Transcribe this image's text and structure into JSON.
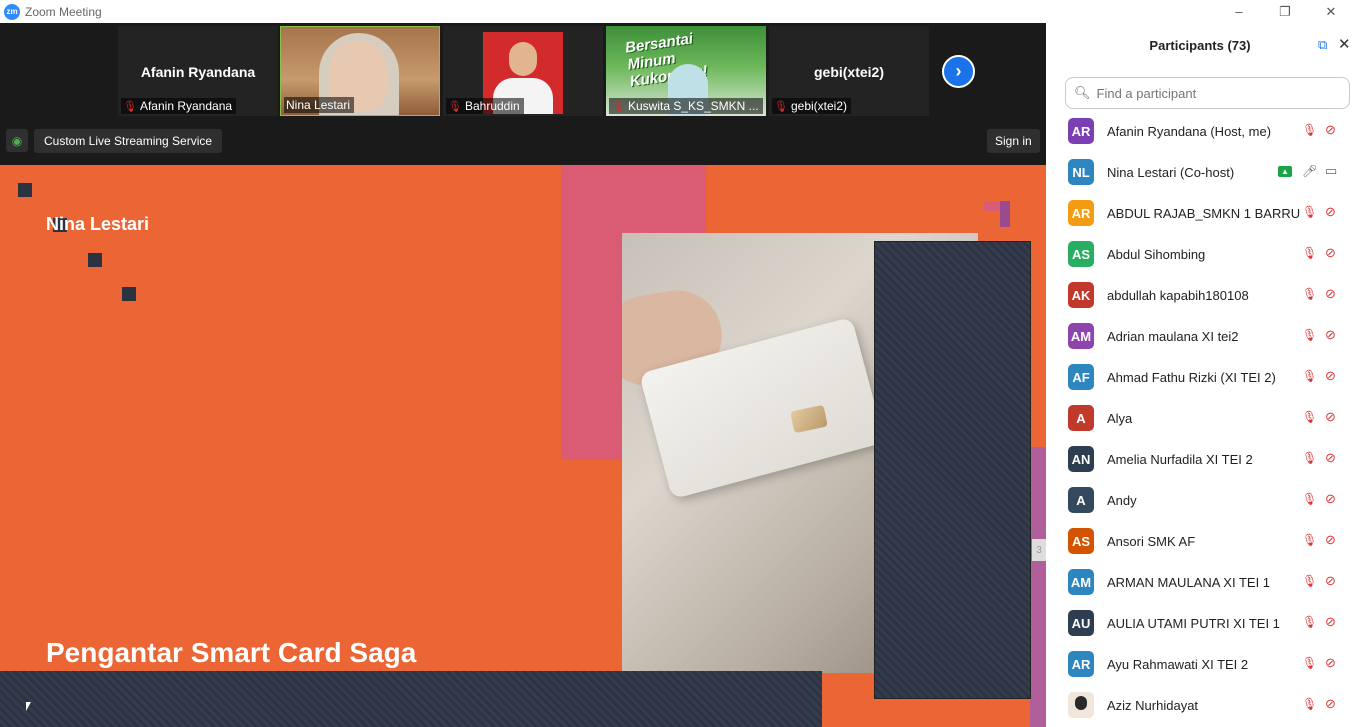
{
  "window": {
    "title": "Zoom Meeting",
    "logo": "zm",
    "buttons": [
      "–",
      "❐",
      "✕"
    ]
  },
  "strip": {
    "tiles": [
      {
        "big_name": "Afanin Ryandana",
        "label": "Afanin Ryandana",
        "muted": true
      },
      {
        "big_name": "",
        "label": "Nina Lestari",
        "muted": false
      },
      {
        "big_name": "",
        "label": "Bahruddin",
        "muted": true
      },
      {
        "big_name": "",
        "label": "Kuswita S_KS_SMKN ...",
        "muted": true,
        "banner": "Bersantai Minum Kukopimu!"
      },
      {
        "big_name": "gebi(xtei2)",
        "label": "gebi(xtei2)",
        "muted": true
      }
    ],
    "next_icon": "›"
  },
  "toolbar": {
    "stream_label": "Custom Live Streaming Service",
    "signin_label": "Sign in"
  },
  "slide": {
    "speaker": "Nina Lestari",
    "title": "Pengantar Smart Card Saga",
    "mini_label": "3"
  },
  "panel": {
    "title": "Participants (73)",
    "search_placeholder": "Find a participant",
    "participants": [
      {
        "initials": "AR",
        "name": "Afanin Ryandana (Host, me)",
        "color": "#7b3fb4",
        "mic": "off",
        "video": "off"
      },
      {
        "initials": "NL",
        "name": "Nina Lestari (Co-host)",
        "color": "#2e86c1",
        "mic": "on",
        "video": "on",
        "sharing": true
      },
      {
        "initials": "AR",
        "name": "ABDUL RAJAB_SMKN 1 BARRU",
        "color": "#f39c12",
        "mic": "off",
        "video": "off"
      },
      {
        "initials": "AS",
        "name": "Abdul Sihombing",
        "color": "#27ae60",
        "mic": "off",
        "video": "off"
      },
      {
        "initials": "AK",
        "name": "abdullah kapabih180108",
        "color": "#c0392b",
        "mic": "off",
        "video": "off"
      },
      {
        "initials": "AM",
        "name": "Adrian maulana XI tei2",
        "color": "#8e44ad",
        "mic": "off",
        "video": "off"
      },
      {
        "initials": "AF",
        "name": "Ahmad Fathu Rizki (XI TEI 2)",
        "color": "#2e86c1",
        "mic": "off",
        "video": "off"
      },
      {
        "initials": "A",
        "name": "Alya",
        "color": "#c0392b",
        "mic": "off",
        "video": "off"
      },
      {
        "initials": "AN",
        "name": "Amelia Nurfadila XI TEI 2",
        "color": "#2c3e50",
        "mic": "off",
        "video": "off"
      },
      {
        "initials": "A",
        "name": "Andy",
        "color": "#34495e",
        "mic": "off",
        "video": "off"
      },
      {
        "initials": "AS",
        "name": "Ansori SMK AF",
        "color": "#d35400",
        "mic": "off",
        "video": "off"
      },
      {
        "initials": "AM",
        "name": "ARMAN MAULANA XI TEI 1",
        "color": "#2e86c1",
        "mic": "off",
        "video": "off"
      },
      {
        "initials": "AU",
        "name": "AULIA UTAMI PUTRI XI TEI 1",
        "color": "#2c3e50",
        "mic": "off",
        "video": "off"
      },
      {
        "initials": "AR",
        "name": "Ayu Rahmawati XI TEI 2",
        "color": "#2e86c1",
        "mic": "off",
        "video": "off"
      },
      {
        "initials": "",
        "name": "Aziz Nurhidayat",
        "color": "#f0e6dc",
        "mic": "off",
        "video": "off",
        "photo": true
      }
    ]
  }
}
